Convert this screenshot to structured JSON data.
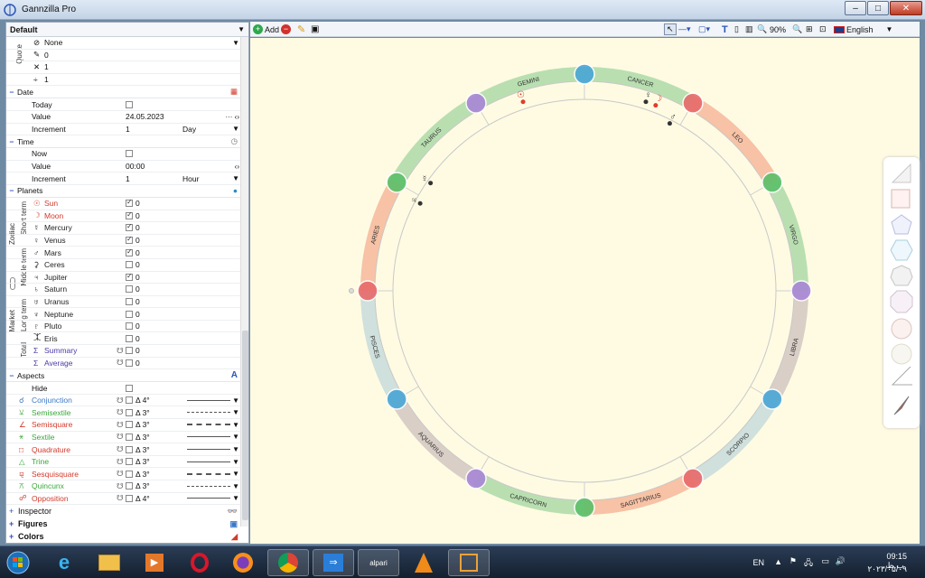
{
  "window": {
    "title": "Gannzilla Pro"
  },
  "profile": {
    "name": "Default"
  },
  "quote": {
    "label": "Quote",
    "rows": [
      {
        "icon": "none-icon",
        "text": "None"
      },
      {
        "icon": "pencil-icon",
        "text": "0"
      },
      {
        "icon": "multiply-icon",
        "text": "1"
      },
      {
        "icon": "divide-icon",
        "text": "1"
      }
    ]
  },
  "date": {
    "label": "Date",
    "today_label": "Today",
    "value_label": "Value",
    "value": "24.05.2023",
    "increment_label": "Increment",
    "increment": "1",
    "unit": "Day"
  },
  "time": {
    "label": "Time",
    "now_label": "Now",
    "value_label": "Value",
    "value": "00:00",
    "increment_label": "Increment",
    "increment": "1",
    "unit": "Hour"
  },
  "planets": {
    "label": "Planets",
    "group_zodiac": "Zodiac",
    "group_market": "Market",
    "short_term": "Short term",
    "middle_term": "Middle term",
    "long_term": "Long term",
    "total": "Total",
    "items": [
      {
        "name": "Sun",
        "glyph": "☉",
        "color": "#d23a2c",
        "checked": true,
        "value": "0"
      },
      {
        "name": "Moon",
        "glyph": "☽",
        "color": "#d23a2c",
        "checked": true,
        "value": "0"
      },
      {
        "name": "Mercury",
        "glyph": "☿",
        "color": "#222222",
        "checked": true,
        "value": "0"
      },
      {
        "name": "Venus",
        "glyph": "♀",
        "color": "#222222",
        "checked": true,
        "value": "0"
      },
      {
        "name": "Mars",
        "glyph": "♂",
        "color": "#222222",
        "checked": true,
        "value": "0"
      },
      {
        "name": "Ceres",
        "glyph": "⚳",
        "color": "#222222",
        "checked": false,
        "value": "0"
      },
      {
        "name": "Jupiter",
        "glyph": "♃",
        "color": "#222222",
        "checked": true,
        "value": "0"
      },
      {
        "name": "Saturn",
        "glyph": "♄",
        "color": "#222222",
        "checked": false,
        "value": "0"
      },
      {
        "name": "Uranus",
        "glyph": "♅",
        "color": "#222222",
        "checked": false,
        "value": "0"
      },
      {
        "name": "Neptune",
        "glyph": "♆",
        "color": "#222222",
        "checked": false,
        "value": "0"
      },
      {
        "name": "Pluto",
        "glyph": "♇",
        "color": "#222222",
        "checked": false,
        "value": "0"
      },
      {
        "name": "Eris",
        "glyph": "⯰",
        "color": "#222222",
        "checked": false,
        "value": "0"
      },
      {
        "name": "Summary",
        "glyph": "Σ",
        "color": "#4b3aa8",
        "checked": false,
        "value": "0"
      },
      {
        "name": "Average",
        "glyph": "Σ",
        "color": "#4b3aa8",
        "checked": false,
        "value": "0"
      }
    ]
  },
  "aspects": {
    "label": "Aspects",
    "hide_label": "Hide",
    "items": [
      {
        "name": "Conjunction",
        "color": "#3a78c8",
        "orb": "Δ 4°",
        "line": "solid"
      },
      {
        "name": "Semisextile",
        "color": "#3aa83a",
        "orb": "Δ 3°",
        "line": "dashed"
      },
      {
        "name": "Semisquare",
        "color": "#d23a2c",
        "orb": "Δ 3°",
        "line": "longdash"
      },
      {
        "name": "Sextile",
        "color": "#3aa83a",
        "orb": "Δ 3°",
        "line": "solid"
      },
      {
        "name": "Quadrature",
        "color": "#d23a2c",
        "orb": "Δ 3°",
        "line": "solid"
      },
      {
        "name": "Trine",
        "color": "#3aa83a",
        "orb": "Δ 3°",
        "line": "solid"
      },
      {
        "name": "Sesquisquare",
        "color": "#d23a2c",
        "orb": "Δ 3°",
        "line": "longdash"
      },
      {
        "name": "Quincunx",
        "color": "#3aa83a",
        "orb": "Δ 3°",
        "line": "dashed"
      },
      {
        "name": "Opposition",
        "color": "#d23a2c",
        "orb": "Δ 4°",
        "line": "solid"
      }
    ]
  },
  "bottom_groups": {
    "inspector": "Inspector",
    "figures": "Figures",
    "colors": "Colors"
  },
  "toolbar": {
    "add_label": "Add",
    "zoom": "90%",
    "language": "English"
  },
  "zodiac": {
    "signs": [
      "GEMINI",
      "CANCER",
      "LEO",
      "VIRGO",
      "LIBRA",
      "SCORPIO",
      "SAGITTARIUS",
      "CAPRICORN",
      "AQUARIUS",
      "PISCES",
      "ARIES",
      "TAURUS"
    ]
  },
  "taskbar": {
    "lang": "EN",
    "time": "09:15 ب.ظ",
    "date": "۲۰۲۳/۰۵/۰۹"
  },
  "colors": {
    "canvas_bg": "#fffbe3",
    "ring_green": "#b9dfb1",
    "ring_orange": "#f7c2a5",
    "ring_gray": "#d9cfc7",
    "ring_blue": "#cfe0dd"
  }
}
